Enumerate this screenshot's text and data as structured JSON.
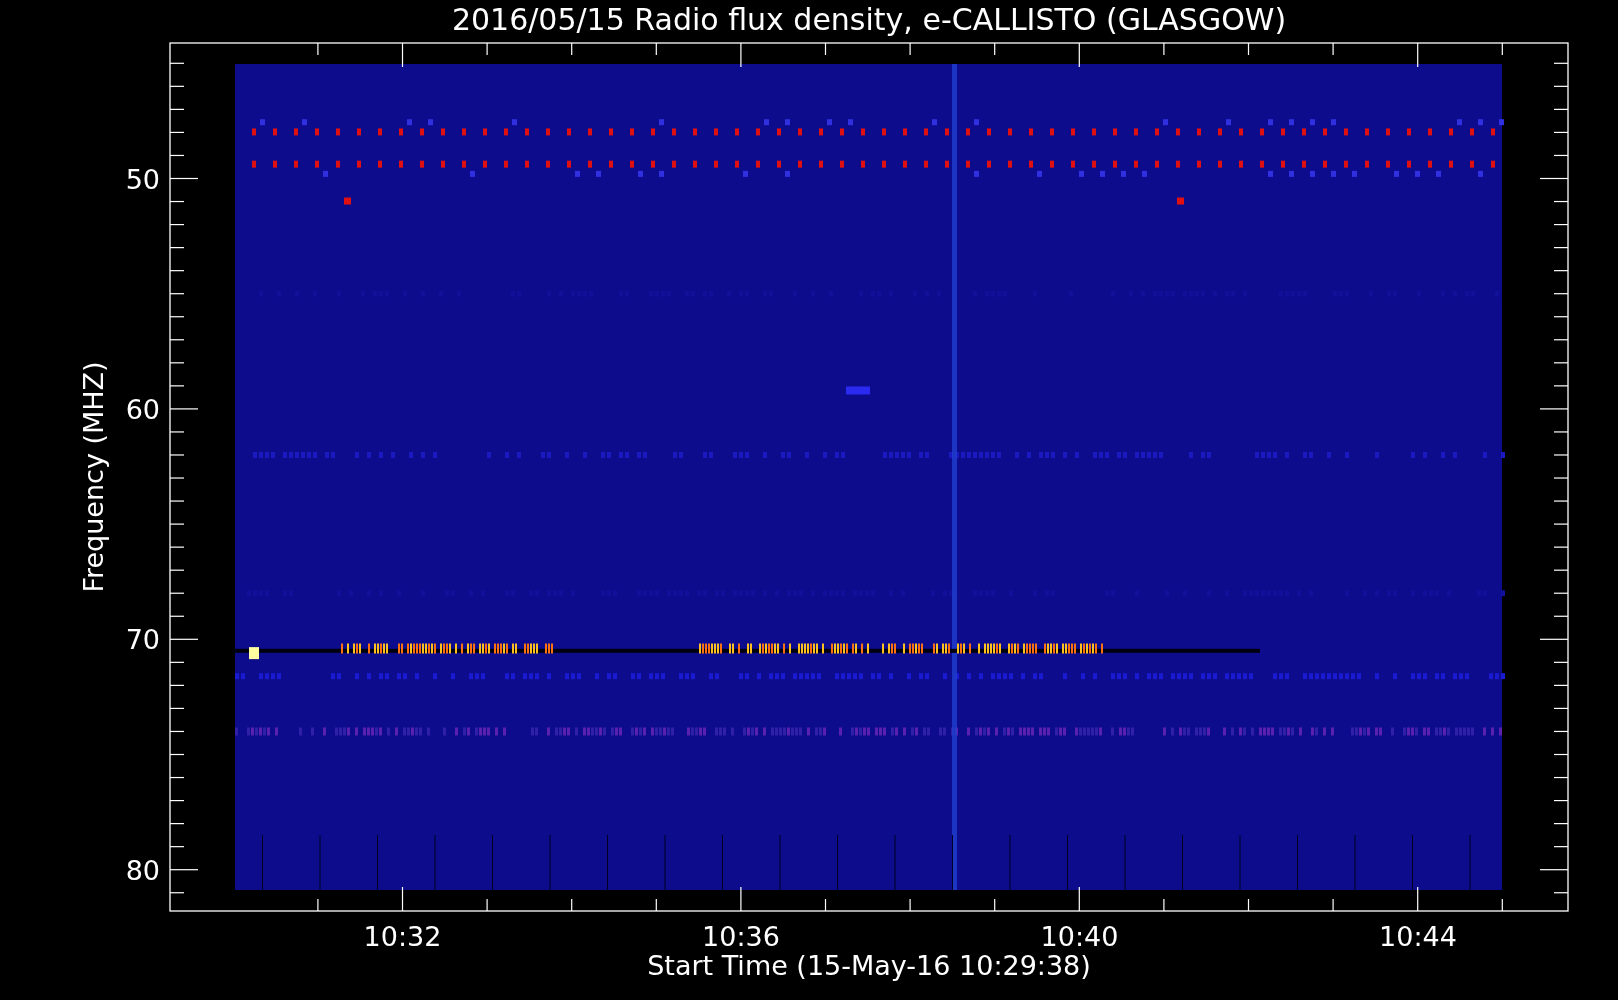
{
  "title": "2016/05/15  Radio flux density, e-CALLISTO (GLASGOW)",
  "y_axis": {
    "title": "Frequency (MHZ)",
    "ticks": [
      "50",
      "60",
      "70",
      "80"
    ]
  },
  "x_axis": {
    "title": "Start Time (15-May-16 10:29:38)",
    "ticks": [
      "10:32",
      "10:36",
      "10:40",
      "10:44"
    ]
  }
}
